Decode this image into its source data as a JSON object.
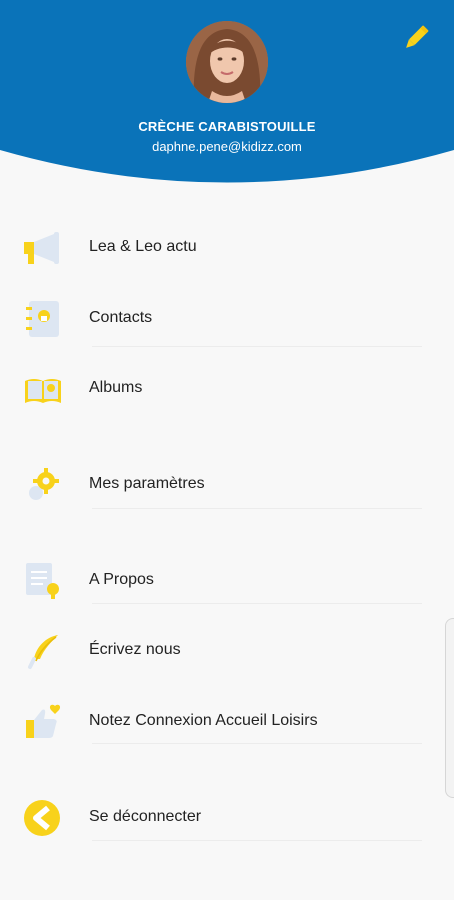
{
  "theme": {
    "header_blue": "#0a73b9",
    "accent_yellow": "#f8d21b",
    "icon_light": "#dde6f2"
  },
  "profile": {
    "org_name": "CRÈCHE CARABISTOUILLE",
    "email": "daphne.pene@kidizz.com",
    "avatar_icon": "avatar",
    "edit_icon": "pencil-icon"
  },
  "menu": {
    "items": [
      {
        "label": "Lea & Leo actu",
        "icon": "megaphone-icon"
      },
      {
        "label": "Contacts",
        "icon": "address-book-icon"
      },
      {
        "label": "Albums",
        "icon": "photo-album-icon"
      },
      {
        "label": "Mes paramètres",
        "icon": "gear-icon"
      },
      {
        "label": "A Propos",
        "icon": "info-document-icon"
      },
      {
        "label": "Écrivez nous",
        "icon": "quill-icon"
      },
      {
        "label": "Notez Connexion Accueil Loisirs",
        "icon": "thumbs-up-heart-icon"
      },
      {
        "label": "Se déconnecter",
        "icon": "logout-icon"
      }
    ]
  }
}
